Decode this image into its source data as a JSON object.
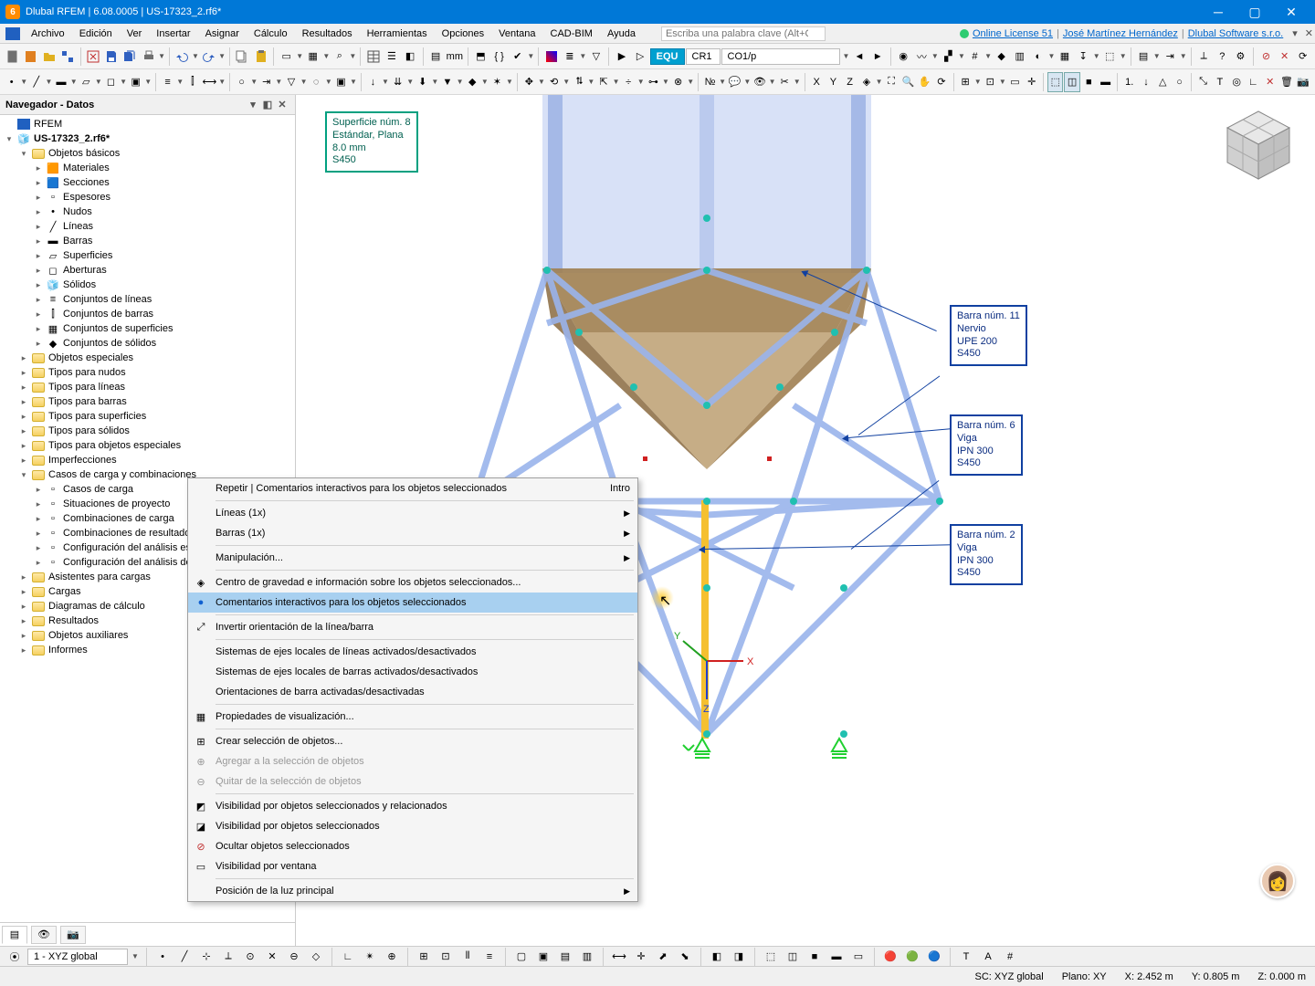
{
  "titlebar": {
    "text": "Dlubal RFEM | 6.08.0005 | US-17323_2.rf6*"
  },
  "menus": [
    "Archivo",
    "Edición",
    "Ver",
    "Insertar",
    "Asignar",
    "Cálculo",
    "Resultados",
    "Herramientas",
    "Opciones",
    "Ventana",
    "CAD-BIM",
    "Ayuda"
  ],
  "menu_search": "Escriba una palabra clave (Alt+Q)",
  "menu_right": {
    "license": "Online License 51",
    "user": "José Martínez Hernández",
    "company": "Dlubal Software s.r.o."
  },
  "tb1": {
    "equ": "EQU",
    "cr": "CR1",
    "co": "CO1/p"
  },
  "navigator": {
    "title": "Navegador - Datos",
    "root": "RFEM",
    "file": "US-17323_2.rf6*",
    "objetos_basicos": "Objetos básicos",
    "ob_items": [
      "Materiales",
      "Secciones",
      "Espesores",
      "Nudos",
      "Líneas",
      "Barras",
      "Superficies",
      "Aberturas",
      "Sólidos",
      "Conjuntos de líneas",
      "Conjuntos de barras",
      "Conjuntos de superficies",
      "Conjuntos de sólidos"
    ],
    "sections": [
      "Objetos especiales",
      "Tipos para nudos",
      "Tipos para líneas",
      "Tipos para barras",
      "Tipos para superficies",
      "Tipos para sólidos",
      "Tipos para objetos especiales",
      "Imperfecciones"
    ],
    "casos": "Casos de carga y combinaciones",
    "casos_items": [
      "Casos de carga",
      "Situaciones de proyecto",
      "Combinaciones de carga",
      "Combinaciones de resultados",
      "Configuración del análisis estático",
      "Configuración del análisis de estabilidad"
    ],
    "bottom": [
      "Asistentes para cargas",
      "Cargas",
      "Diagramas de cálculo",
      "Resultados",
      "Objetos auxiliares",
      "Informes"
    ]
  },
  "anno": {
    "surf": [
      "Superficie núm. 8",
      "Estándar, Plana",
      "8.0 mm",
      "S450"
    ],
    "b11": [
      "Barra núm. 11",
      "Nervio",
      "UPE 200",
      "S450"
    ],
    "b6": [
      "Barra núm. 6",
      "Viga",
      "IPN 300",
      "S450"
    ],
    "b2": [
      "Barra núm. 2",
      "Viga",
      "IPN 300",
      "S450"
    ]
  },
  "axes": {
    "x": "X",
    "y": "Y",
    "z": "Z"
  },
  "ctx": {
    "repeat": "Repetir | Comentarios interactivos para los objetos seleccionados",
    "repeat_key": "Intro",
    "lineas": "Líneas (1x)",
    "barras": "Barras (1x)",
    "manip": "Manipulación...",
    "cog": "Centro de gravedad e información sobre los objetos seleccionados...",
    "comments": "Comentarios interactivos para los objetos seleccionados",
    "invert": "Invertir orientación de la línea/barra",
    "ejes_lineas": "Sistemas de ejes locales de líneas activados/desactivados",
    "ejes_barras": "Sistemas de ejes locales de barras activados/desactivados",
    "orient": "Orientaciones de barra activadas/desactivadas",
    "disp_props": "Propiedades de visualización...",
    "crear_sel": "Crear selección de objetos...",
    "agregar": "Agregar a la selección de objetos",
    "quitar": "Quitar de la selección de objetos",
    "vis_rel": "Visibilidad por objetos seleccionados y relacionados",
    "vis_sel": "Visibilidad por objetos seleccionados",
    "ocultar": "Ocultar objetos seleccionados",
    "vis_vent": "Visibilidad por ventana",
    "luz": "Posición de la luz principal"
  },
  "status": {
    "view": "1 - XYZ global",
    "sc": "SC: XYZ global",
    "plano": "Plano: XY",
    "x": "X: 2.452 m",
    "y": "Y: 0.805 m",
    "z": "Z: 0.000 m"
  }
}
